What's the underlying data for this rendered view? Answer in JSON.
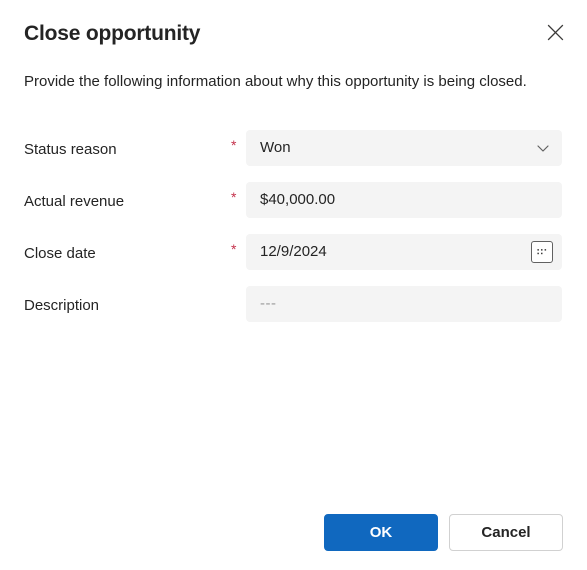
{
  "dialog": {
    "title": "Close opportunity",
    "description": "Provide the following information about why this opportunity is being closed.",
    "close_icon": "close-icon",
    "accent_color": "#1068bf",
    "required_color": "#c4314b",
    "field_background": "#f4f4f4",
    "text_color": "#242424",
    "placeholder_color": "#9b9b9b"
  },
  "form": {
    "required_marker": "*",
    "fields": [
      {
        "label": "Status reason",
        "required": true,
        "value": "Won",
        "placeholder": "",
        "control": "dropdown",
        "icon": "chevron-down-icon"
      },
      {
        "label": "Actual revenue",
        "required": true,
        "value": "$40,000.00",
        "placeholder": "",
        "control": "text",
        "icon": ""
      },
      {
        "label": "Close date",
        "required": true,
        "value": "12/9/2024",
        "placeholder": "",
        "control": "date",
        "icon": "calendar-icon"
      },
      {
        "label": "Description",
        "required": false,
        "value": "",
        "placeholder": "---",
        "control": "text",
        "icon": ""
      }
    ]
  },
  "footer": {
    "ok_label": "OK",
    "cancel_label": "Cancel"
  }
}
